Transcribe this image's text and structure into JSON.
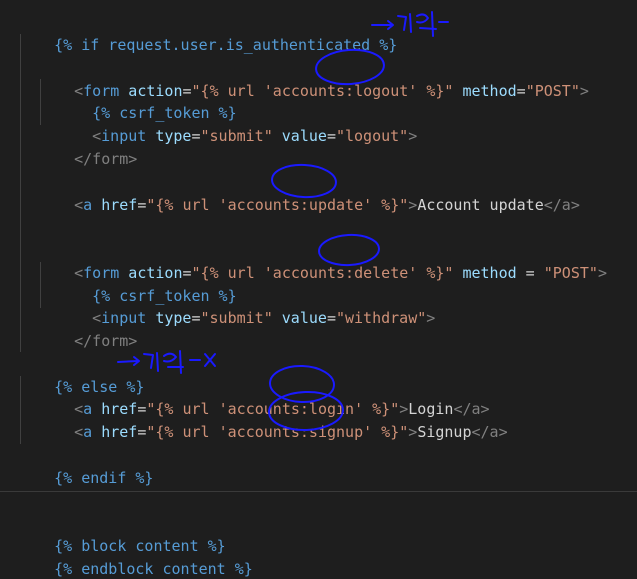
{
  "code": {
    "l1_if": "{% if request.user.is_authenticated %}",
    "form_open": "<",
    "form_tag": "form",
    "action_attr": " action",
    "eq": "=",
    "url_logout": "\"{% url 'accounts:logout' %}\"",
    "method_attr": " method",
    "post_str": "\"POST\"",
    "close_gt": ">",
    "csrf": "{% csrf_token %}",
    "input_tag": "input",
    "type_attr": " type",
    "submit_str": "\"submit\"",
    "value_attr": " value",
    "logout_str": "\"logout\"",
    "form_close": "</form>",
    "a_tag": "a",
    "href_attr": " href",
    "url_update": "\"{% url 'accounts:update' %}\"",
    "account_update_text": "Account update",
    "a_close": "</a>",
    "url_delete": "\"{% url 'accounts:delete' %}\"",
    "method_eq": " = ",
    "withdraw_str": "\"withdraw\"",
    "else": "{% else %}",
    "url_login": "\"{% url 'accounts:login' %}\"",
    "login_text": "Login",
    "url_signup": "\"{% url 'accounts:signup' %}\"",
    "signup_text": "Signup",
    "endif": "{% endif %}",
    "block_content": "{% block content %}",
    "endblock_content": "{% endblock content %}"
  },
  "colors": {
    "background": "#1e1e1e",
    "template_tag": "#569cd6",
    "attribute": "#9cdcfe",
    "string": "#ce9178",
    "annotation_ink": "#1a1aff"
  }
}
